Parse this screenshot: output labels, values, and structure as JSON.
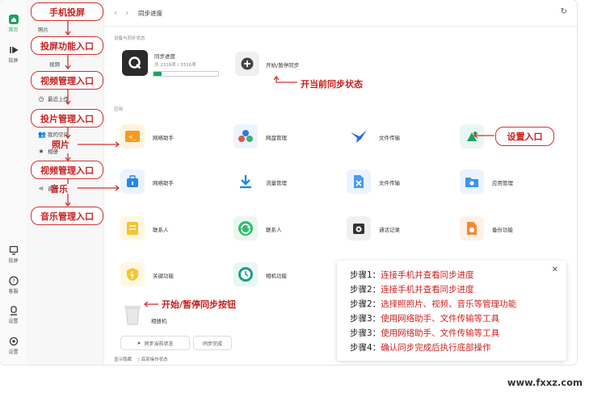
{
  "rail": {
    "items": [
      {
        "label": "首页",
        "icon": "home-icon"
      },
      {
        "label": "投屏",
        "icon": "cast-icon"
      },
      {
        "label": "投屏",
        "icon": "screen-icon"
      },
      {
        "label": "客服",
        "icon": "help-icon"
      },
      {
        "label": "设置",
        "icon": "user-icon"
      },
      {
        "label": "设置",
        "icon": "settings-icon"
      }
    ],
    "active_color": "#1aa260"
  },
  "sidebar": {
    "items": [
      "照片",
      "视频",
      "最近上传",
      "我的空间",
      "相册",
      "音乐"
    ]
  },
  "header": {
    "title": "同步进度"
  },
  "sync_section": {
    "label": "设备与同步状态",
    "progress_title": "同步进度",
    "progress_sub": "共 2318项 / 3316项",
    "progress_fraction": 0.12,
    "start_label": "开始/暂停同步"
  },
  "tools_section": {
    "label": "应用",
    "apps": [
      {
        "label": "网络助手"
      },
      {
        "label": "网盘管理"
      },
      {
        "label": "文件传输"
      },
      {
        "label": ""
      },
      {
        "label": "网络助手"
      },
      {
        "label": "流量管理"
      },
      {
        "label": "文件传输"
      },
      {
        "label": "应用管理"
      },
      {
        "label": "联系人"
      },
      {
        "label": "联系人"
      },
      {
        "label": "通话记录"
      },
      {
        "label": "备份功能"
      },
      {
        "label": "关键功能"
      },
      {
        "label": "相机功能"
      }
    ]
  },
  "bottom": {
    "trash_label": "相册机",
    "btn_sync_album": "同步当前状态",
    "btn_sync_done": "同步完成",
    "footer_left": "显示隐藏",
    "footer_right": "| 底部操作状态"
  },
  "annotations": {
    "phone_cast": "手机投屏",
    "cast_entry": "投屏功能入口",
    "video_label": "视频",
    "video_mgmt": "视频管理入口",
    "photo_mgmt": "投片管理入口",
    "photo": "照片",
    "video_mgmt2": "视频管理入口",
    "music": "音乐",
    "music_mgmt": "音乐管理入口",
    "sync_status": "开当前同步状态",
    "settings_entry": "设置入口",
    "start_pause_btn": "开始/暂停同步按钮"
  },
  "steps": [
    {
      "k": "步骤1：",
      "v": "连接手机并查看同步进度"
    },
    {
      "k": "步骤2：",
      "v": "连接手机并查看同步进度"
    },
    {
      "k": "步骤2：",
      "v": "选择照照片、视频、音乐等管理功能"
    },
    {
      "k": "步骤3：",
      "v": "使用网络助手、文件传输等工具"
    },
    {
      "k": "步骤3：",
      "v": "使用网络助手、文件传输等工具"
    },
    {
      "k": "步骤4：",
      "v": "确认同步完成后执行底部操作"
    }
  ],
  "watermark": "www.fxxz.com"
}
